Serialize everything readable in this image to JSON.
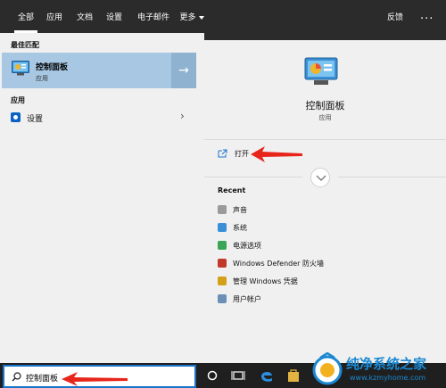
{
  "topbar": {
    "tabs": [
      {
        "label": "全部",
        "active": true
      },
      {
        "label": "应用",
        "active": false
      },
      {
        "label": "文档",
        "active": false
      },
      {
        "label": "设置",
        "active": false
      },
      {
        "label": "电子邮件",
        "active": false
      },
      {
        "label": "更多",
        "active": false
      }
    ],
    "feedback": "反馈",
    "more_dots": "..."
  },
  "left": {
    "best_match_label": "最佳匹配",
    "best_match": {
      "title": "控制面板",
      "subtitle": "应用"
    },
    "apps_label": "应用",
    "settings_item": "设置"
  },
  "right": {
    "title": "控制面板",
    "subtitle": "应用",
    "open_label": "打开",
    "recent_title": "Recent",
    "recent_items": [
      {
        "label": "声音",
        "icon": "speaker-icon",
        "color": "#9a9a9a"
      },
      {
        "label": "系统",
        "icon": "system-icon",
        "color": "#3a8fd6"
      },
      {
        "label": "电源选项",
        "icon": "power-icon",
        "color": "#3aa655"
      },
      {
        "label": "Windows Defender 防火墙",
        "icon": "firewall-icon",
        "color": "#c0392b"
      },
      {
        "label": "管理 Windows 凭据",
        "icon": "credentials-icon",
        "color": "#d4a017"
      },
      {
        "label": "用户帐户",
        "icon": "users-icon",
        "color": "#6b8fb5"
      }
    ]
  },
  "taskbar": {
    "search_value": "控制面板"
  },
  "watermark": {
    "brand": "纯净系统之家",
    "url": "www.kzmyhome.com"
  }
}
